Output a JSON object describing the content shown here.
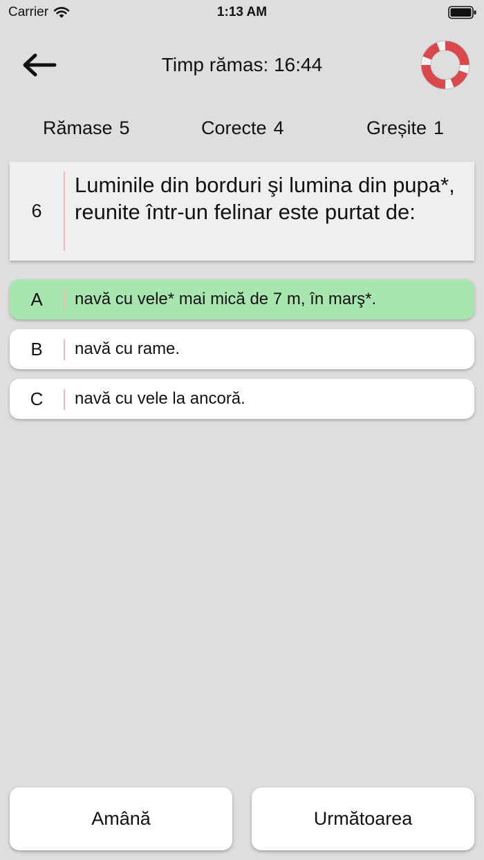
{
  "status_bar": {
    "carrier": "Carrier",
    "time": "1:13 AM"
  },
  "header": {
    "timer": "Timp rămas: 16:44"
  },
  "stats": {
    "remaining": {
      "label": "Rămase",
      "value": "5"
    },
    "correct": {
      "label": "Corecte",
      "value": "4"
    },
    "wrong": {
      "label": "Greșite",
      "value": "1"
    }
  },
  "question": {
    "number": "6",
    "text": "Luminile din borduri şi lumina din pupa*, reunite într-un felinar este purtat de:"
  },
  "answers": [
    {
      "letter": "A",
      "text": "navă cu vele* mai mică de 7 m, în marş*.",
      "state": "correct"
    },
    {
      "letter": "B",
      "text": "navă cu rame.",
      "state": "normal"
    },
    {
      "letter": "C",
      "text": "navă cu vele la ancoră.",
      "state": "normal"
    }
  ],
  "buttons": {
    "postpone": "Amână",
    "next": "Următoarea"
  },
  "colors": {
    "background": "#dedede",
    "correct": "#a8e6b0",
    "divider": "#f0b8b8",
    "lifebuoy_red": "#d9484c"
  },
  "icons": {
    "back": "back-arrow-icon",
    "help": "lifebuoy-icon",
    "wifi": "wifi-icon",
    "battery": "battery-icon"
  }
}
